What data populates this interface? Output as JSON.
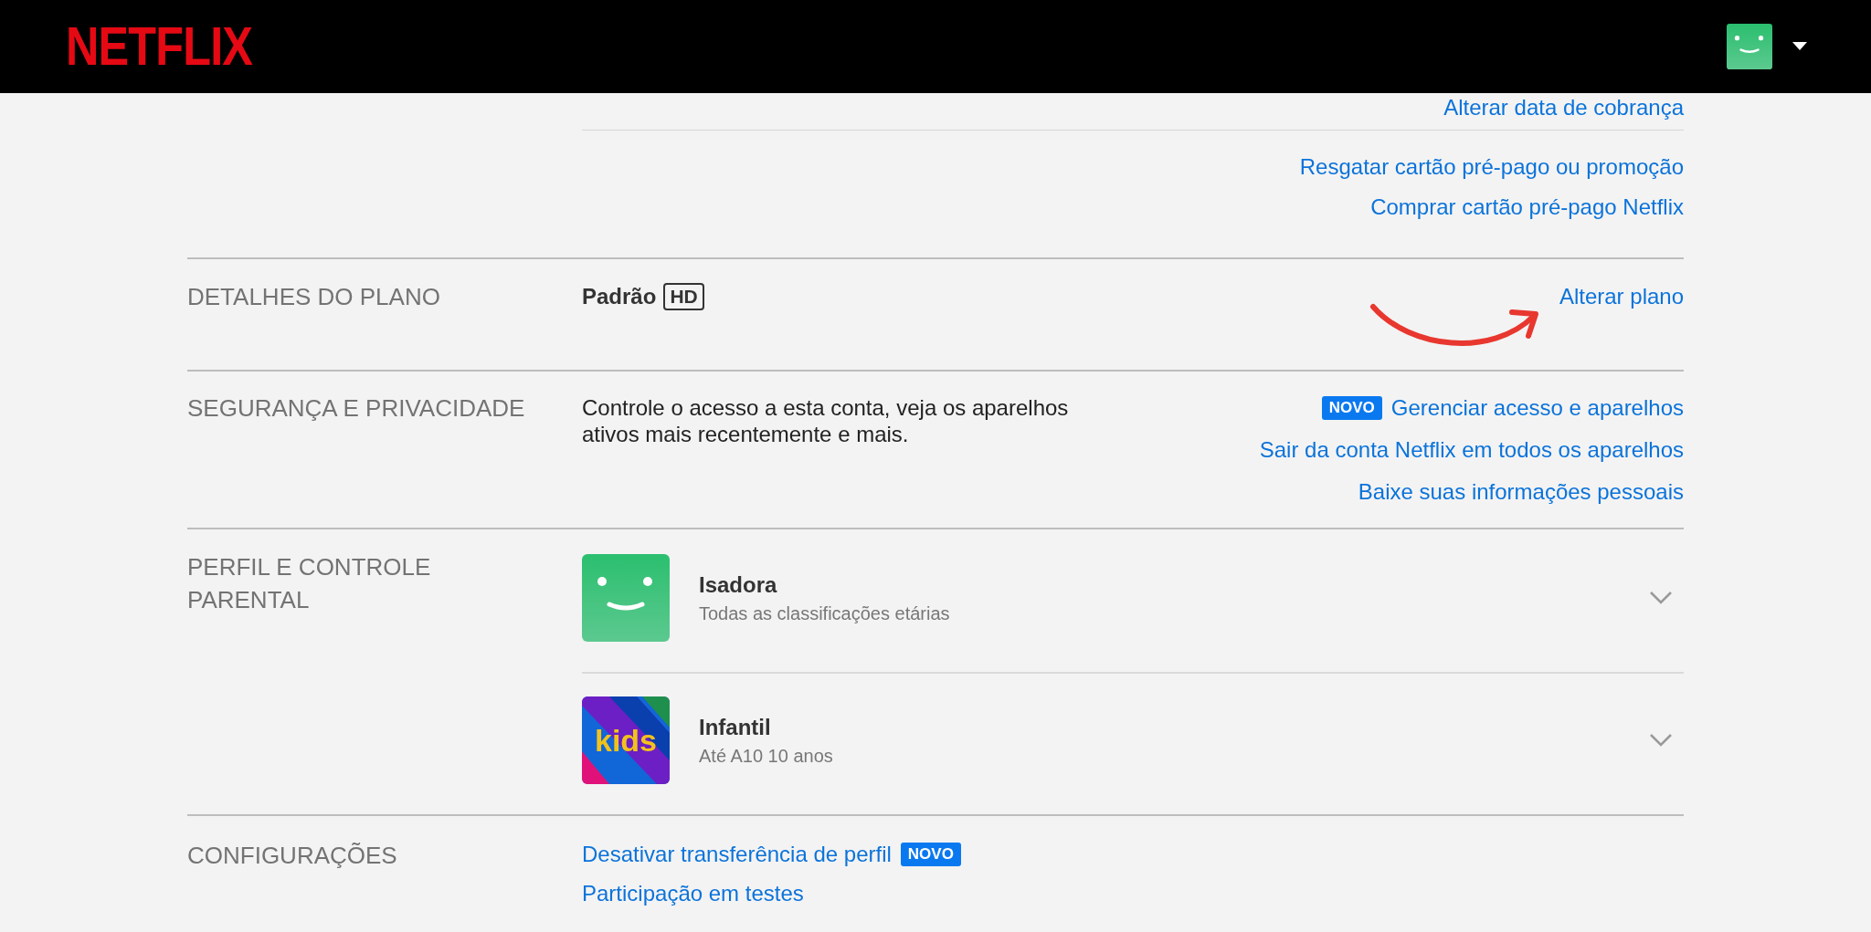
{
  "header": {
    "logo": "NETFLIX",
    "profile_avatar": {
      "kind": "smile"
    }
  },
  "billing": {
    "links": [
      {
        "text": "Alterar data de cobrança"
      }
    ],
    "extra_links": [
      {
        "text": "Resgatar cartão pré-pago ou promoção"
      },
      {
        "text": "Comprar cartão pré-pago Netflix"
      }
    ]
  },
  "sections": [
    {
      "kind": "plan",
      "title": "DETALHES DO PLANO",
      "plan": "Padrão",
      "quality": "HD",
      "annotation": {
        "kind": "arrow"
      },
      "links": [
        {
          "kind": "plain",
          "text": "Alterar plano"
        }
      ]
    },
    {
      "kind": "text",
      "title": "SEGURANÇA E PRIVACIDADE",
      "description": "Controle o acesso a esta conta, veja os aparelhos ativos mais recentemente e mais.",
      "links": [
        {
          "kind": "badge-first",
          "text": "Gerenciar acesso e aparelhos",
          "badge": "NOVO"
        },
        {
          "kind": "plain",
          "text": "Sair da conta Netflix em todos os aparelhos"
        },
        {
          "kind": "plain",
          "text": "Baixe suas informações pessoais"
        }
      ]
    },
    {
      "kind": "profiles",
      "title": "PERFIL E CONTROLE PARENTAL",
      "profiles": [
        {
          "name": "Isadora",
          "subtitle": "Todas as classificações etárias",
          "avatar": {
            "kind": "smile"
          },
          "expanded": false
        },
        {
          "name": "Infantil",
          "subtitle": "Até A10 10 anos",
          "avatar": {
            "kind": "kids",
            "label": "kids"
          },
          "expanded": false
        }
      ]
    },
    {
      "kind": "settings",
      "title": "CONFIGURAÇÕES",
      "links": [
        {
          "kind": "badge-last",
          "text": "Desativar transferência de perfil",
          "badge": "NOVO"
        },
        {
          "kind": "plain",
          "text": "Participação em testes"
        }
      ]
    }
  ]
}
